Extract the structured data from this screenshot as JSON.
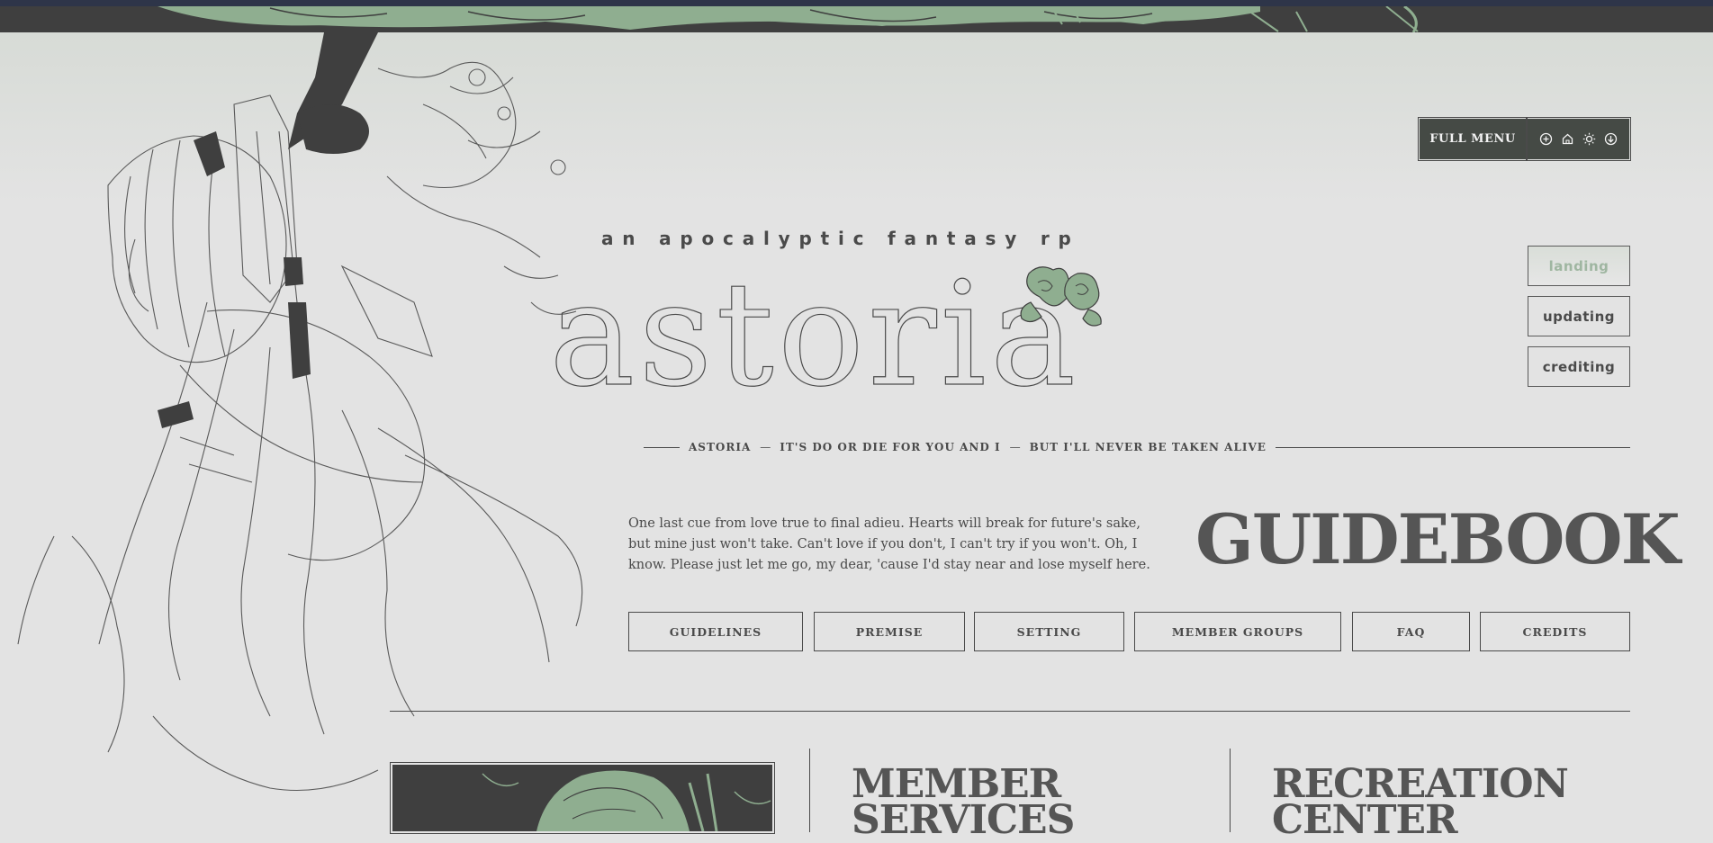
{
  "header": {
    "full_menu_label": "FULL MENU",
    "quick_icons": [
      "plus-circle-icon",
      "home-icon",
      "sun-icon",
      "arrow-down-circle-icon"
    ]
  },
  "side_nav": {
    "items": [
      {
        "label": "landing",
        "active": true
      },
      {
        "label": "updating",
        "active": false
      },
      {
        "label": "crediting",
        "active": false
      }
    ]
  },
  "logo": {
    "tagline": "an apocalyptic fantasy rp",
    "name": "astoria"
  },
  "lyric_line": {
    "site": "ASTORIA",
    "line1": "IT'S DO OR DIE FOR YOU AND I",
    "line2": "BUT I'LL NEVER BE TAKEN ALIVE",
    "separator": "—"
  },
  "intro": {
    "text": "One last cue from love true to final adieu. Hearts will break for future's sake, but mine just won't take. Can't love if you don't, I can't try if you won't. Oh, I know. Please just let me go, my dear, 'cause I'd stay near and lose myself here."
  },
  "page_title": "GUIDEBOOK",
  "tabs": [
    {
      "label": "GUIDELINES"
    },
    {
      "label": "PREMISE"
    },
    {
      "label": "SETTING"
    },
    {
      "label": "MEMBER GROUPS"
    },
    {
      "label": "FAQ"
    },
    {
      "label": "CREDITS"
    }
  ],
  "sections": {
    "member_services": "MEMBER SERVICES",
    "recreation_center": "RECREATION CENTER"
  },
  "colors": {
    "accent_green": "#8fae90",
    "dark": "#454a45",
    "ink": "#4a4a4a",
    "background": "#e3e3e3",
    "top_accent": "#2e3549"
  }
}
